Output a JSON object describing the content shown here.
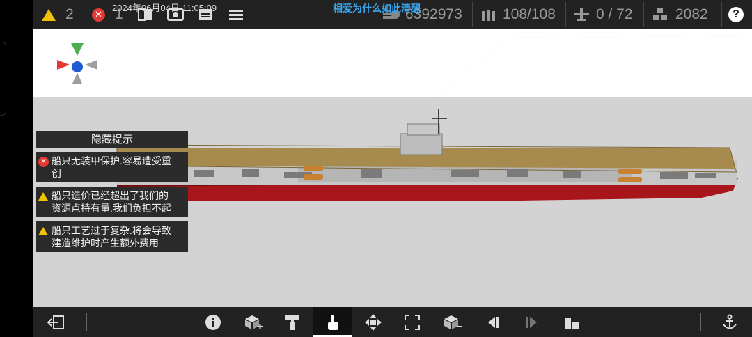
{
  "overlay": {
    "timestamp": "2024年06月04日 11:05:09",
    "watermark": "相爱为什么如此清醒"
  },
  "topbar": {
    "warning_count": "2",
    "error_count": "1",
    "cost": "6392973",
    "ammo": "108/108",
    "aircraft": "0 / 72",
    "resources": "2082",
    "help": "?"
  },
  "hints": {
    "header": "隐藏提示",
    "items": [
      {
        "type": "error",
        "line1": "船只无装甲保护.容易遭受重",
        "line2": "创"
      },
      {
        "type": "warning",
        "line1": "船只造价已经超出了我们的",
        "line2": "资源点持有量.我们负担不起"
      },
      {
        "type": "warning",
        "line1": "船只工艺过于复杂.将会导致",
        "line2": "建造维护时产生额外费用"
      }
    ]
  },
  "bottombar": {
    "active_tool": "touch-select"
  },
  "colors": {
    "bar_bg": "#222222",
    "warning": "#f2c200",
    "error": "#e53935",
    "hull_red": "#a8161c",
    "deck": "#a68a4e",
    "viewport_bg": "#d3d3d3"
  }
}
